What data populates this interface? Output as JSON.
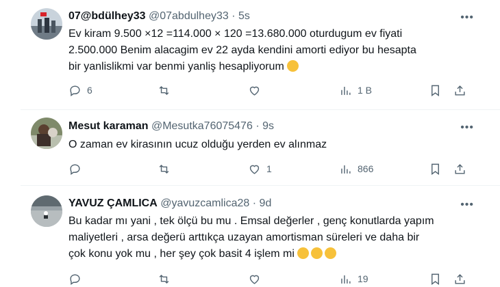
{
  "tweets": [
    {
      "name": "07@bdülhey33",
      "handle": "@07abdulhey33",
      "sep": "·",
      "time": "5s",
      "lines": [
        "Ev kiram 9.500 ×12 =114.000 × 120 =13.680.000 oturdugum ev fiyati",
        "2.500.000     Benim alacagim ev 22 ayda kendini amorti ediyor bu hesapta",
        "bir yanlislikmi var benmi yanliş hesapliyorum"
      ],
      "emoji": "thinking-face",
      "replies": "6",
      "retweets": "",
      "likes": "",
      "views": "1 B"
    },
    {
      "name": "Mesut karaman",
      "handle": "@Mesutka76075476",
      "sep": "·",
      "time": "9s",
      "lines": [
        "O zaman ev kirasının ucuz olduğu yerden ev alınmaz"
      ],
      "replies": "",
      "retweets": "",
      "likes": "1",
      "views": "866"
    },
    {
      "name": "YAVUZ ÇAMLICA",
      "handle": "@yavuzcamlica28",
      "sep": "·",
      "time": "9d",
      "lines": [
        "Bu kadar mı yani , tek ölçü bu mu . Emsal değerler , genç konutlarda yapım",
        "maliyetleri , arsa değerü arttıkça uzayan amortisman süreleri ve daha bir",
        "çok konu yok mu , her şey çok basit 4 işlem mi"
      ],
      "emoji": "grinning-face",
      "replies": "",
      "retweets": "",
      "likes": "",
      "views": "19"
    }
  ],
  "colors": {
    "text": "#0f1419",
    "secondary": "#536471",
    "divider": "#eff3f4"
  }
}
